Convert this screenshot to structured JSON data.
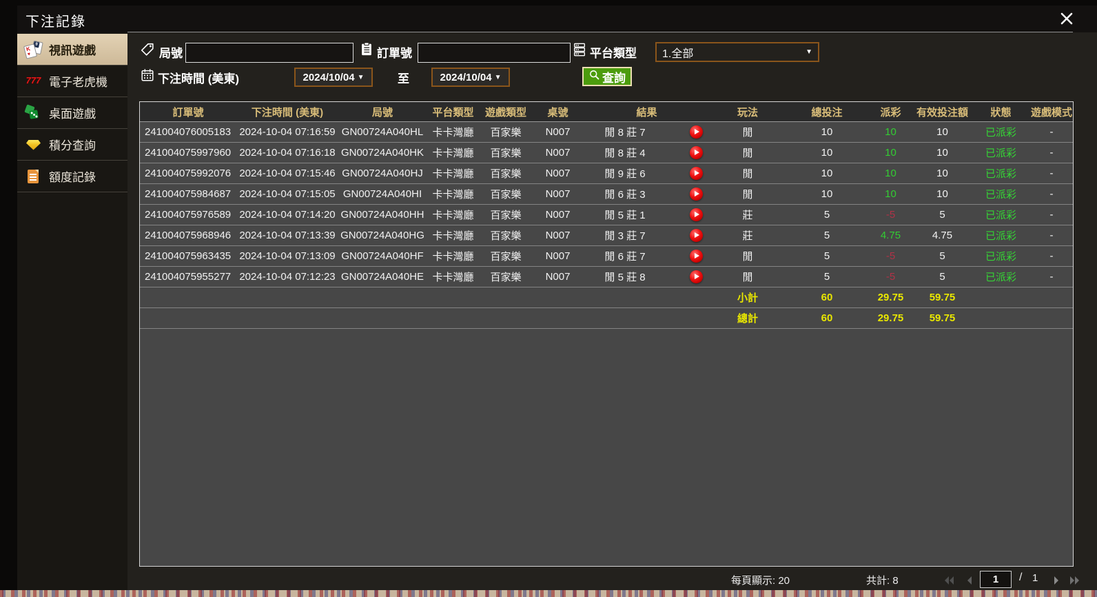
{
  "window": {
    "title": "下注記錄"
  },
  "sidebar": {
    "items": [
      {
        "label": "視訊遊戲",
        "icon": "playing-cards-icon",
        "selected": true
      },
      {
        "label": "電子老虎機",
        "icon": "slot-777-icon",
        "selected": false
      },
      {
        "label": "桌面遊戲",
        "icon": "table-games-icon",
        "selected": false
      },
      {
        "label": "積分查詢",
        "icon": "points-diamond-icon",
        "selected": false
      },
      {
        "label": "額度記錄",
        "icon": "quota-document-icon",
        "selected": false
      }
    ]
  },
  "filters": {
    "round_label": "局號",
    "round_value": "",
    "order_label": "訂單號",
    "order_value": "",
    "platform_label": "平台類型",
    "platform_value": "1.全部",
    "time_label": "下注時間 (美東)",
    "date_from": "2024/10/04",
    "to_label": "至",
    "date_to": "2024/10/04",
    "search_label": "查詢"
  },
  "icons": {
    "caret": "▼"
  },
  "table": {
    "headers": [
      "訂單號",
      "下注時間 (美東)",
      "局號",
      "平台類型",
      "遊戲類型",
      "桌號",
      "結果",
      "玩法",
      "總投注",
      "派彩",
      "有效投注額",
      "狀態",
      "遊戲模式"
    ],
    "rows": [
      {
        "order_no": "241004076005183",
        "bet_time": "2024-10-04 07:16:59",
        "round_no": "GN00724A040HL",
        "platform": "卡卡灣廳",
        "game_type": "百家樂",
        "table_no": "N007",
        "result": "閒 8 莊 7",
        "play": "閒",
        "total_bet": "10",
        "payout": "10",
        "payout_positive": true,
        "valid_bet": "10",
        "status": "已派彩",
        "game_mode": "-"
      },
      {
        "order_no": "241004075997960",
        "bet_time": "2024-10-04 07:16:18",
        "round_no": "GN00724A040HK",
        "platform": "卡卡灣廳",
        "game_type": "百家樂",
        "table_no": "N007",
        "result": "閒 8 莊 4",
        "play": "閒",
        "total_bet": "10",
        "payout": "10",
        "payout_positive": true,
        "valid_bet": "10",
        "status": "已派彩",
        "game_mode": "-"
      },
      {
        "order_no": "241004075992076",
        "bet_time": "2024-10-04 07:15:46",
        "round_no": "GN00724A040HJ",
        "platform": "卡卡灣廳",
        "game_type": "百家樂",
        "table_no": "N007",
        "result": "閒 9 莊 6",
        "play": "閒",
        "total_bet": "10",
        "payout": "10",
        "payout_positive": true,
        "valid_bet": "10",
        "status": "已派彩",
        "game_mode": "-"
      },
      {
        "order_no": "241004075984687",
        "bet_time": "2024-10-04 07:15:05",
        "round_no": "GN00724A040HI",
        "platform": "卡卡灣廳",
        "game_type": "百家樂",
        "table_no": "N007",
        "result": "閒 6 莊 3",
        "play": "閒",
        "total_bet": "10",
        "payout": "10",
        "payout_positive": true,
        "valid_bet": "10",
        "status": "已派彩",
        "game_mode": "-"
      },
      {
        "order_no": "241004075976589",
        "bet_time": "2024-10-04 07:14:20",
        "round_no": "GN00724A040HH",
        "platform": "卡卡灣廳",
        "game_type": "百家樂",
        "table_no": "N007",
        "result": "閒 5 莊 1",
        "play": "莊",
        "total_bet": "5",
        "payout": "-5",
        "payout_positive": false,
        "valid_bet": "5",
        "status": "已派彩",
        "game_mode": "-"
      },
      {
        "order_no": "241004075968946",
        "bet_time": "2024-10-04 07:13:39",
        "round_no": "GN00724A040HG",
        "platform": "卡卡灣廳",
        "game_type": "百家樂",
        "table_no": "N007",
        "result": "閒 3 莊 7",
        "play": "莊",
        "total_bet": "5",
        "payout": "4.75",
        "payout_positive": true,
        "valid_bet": "4.75",
        "status": "已派彩",
        "game_mode": "-"
      },
      {
        "order_no": "241004075963435",
        "bet_time": "2024-10-04 07:13:09",
        "round_no": "GN00724A040HF",
        "platform": "卡卡灣廳",
        "game_type": "百家樂",
        "table_no": "N007",
        "result": "閒 6 莊 7",
        "play": "閒",
        "total_bet": "5",
        "payout": "-5",
        "payout_positive": false,
        "valid_bet": "5",
        "status": "已派彩",
        "game_mode": "-"
      },
      {
        "order_no": "241004075955277",
        "bet_time": "2024-10-04 07:12:23",
        "round_no": "GN00724A040HE",
        "platform": "卡卡灣廳",
        "game_type": "百家樂",
        "table_no": "N007",
        "result": "閒 5 莊 8",
        "play": "閒",
        "total_bet": "5",
        "payout": "-5",
        "payout_positive": false,
        "valid_bet": "5",
        "status": "已派彩",
        "game_mode": "-"
      }
    ],
    "subtotal": {
      "label": "小計",
      "total_bet": "60",
      "payout": "29.75",
      "valid_bet": "59.75"
    },
    "grand_total": {
      "label": "總計",
      "total_bet": "60",
      "payout": "29.75",
      "valid_bet": "59.75"
    }
  },
  "pagination": {
    "page_size_label": "每頁顯示: 20",
    "total_label": "共計: 8",
    "current_page": "1",
    "separator": "/",
    "total_pages": "1"
  },
  "colors": {
    "accent_green": "#4c9c0d",
    "header_gold": "#d9bd79",
    "positive_green": "#32cd32",
    "negative_red": "#b13247",
    "total_yellow": "#e9e700",
    "selected_tan": "#d8c6a7",
    "picker_border": "#8a551b"
  }
}
